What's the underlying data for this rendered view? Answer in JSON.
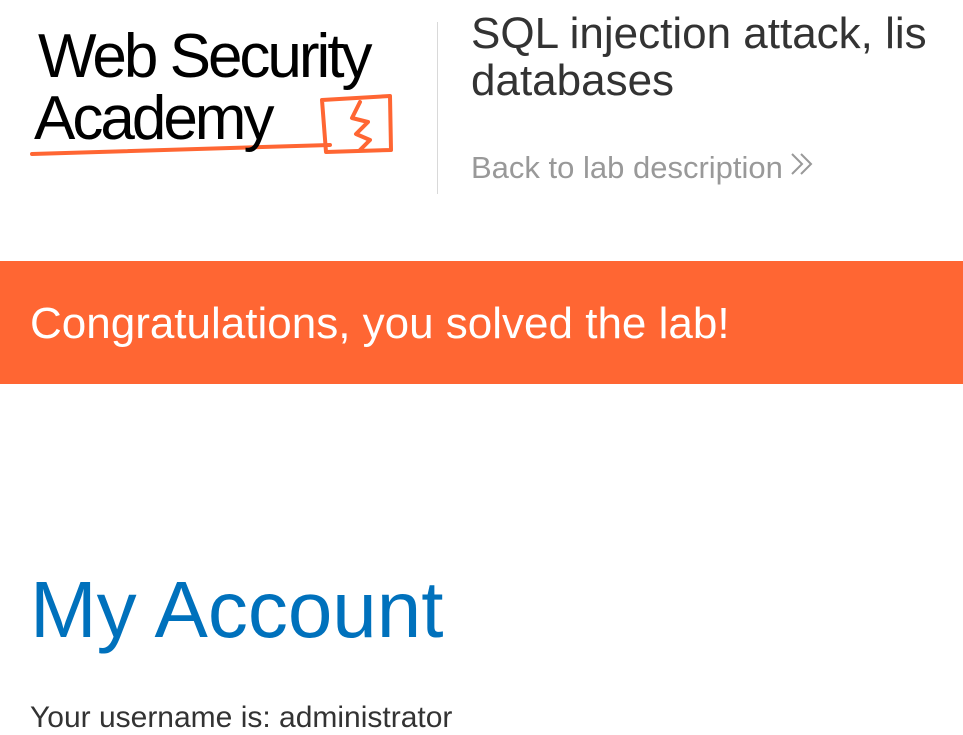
{
  "logo": {
    "line1": "Web Security",
    "line2": "Academy",
    "accent_color": "#ff6633"
  },
  "header": {
    "lab_title_line1": "SQL injection attack, lis",
    "lab_title_line2": "databases",
    "back_link_label": "Back to lab description",
    "back_link_icon": "double-chevron-right-icon"
  },
  "banner": {
    "message": "Congratulations, you solved the lab!",
    "color": "#ff6633"
  },
  "main": {
    "page_title": "My Account",
    "username_text": "Your username is: administrator",
    "title_color": "#0071bc"
  }
}
